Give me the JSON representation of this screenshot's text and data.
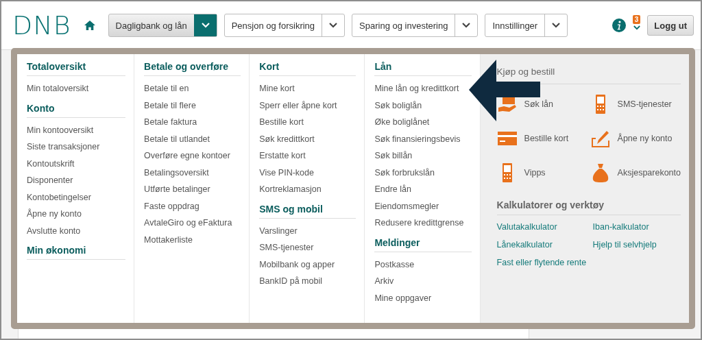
{
  "logo": "DNB",
  "nav": [
    {
      "label": "Dagligbank og lån",
      "selected": true
    },
    {
      "label": "Pensjon og forsikring",
      "selected": false
    },
    {
      "label": "Sparing og investering",
      "selected": false
    },
    {
      "label": "Innstillinger",
      "selected": false
    }
  ],
  "notification_count": "3",
  "logout": "Logg ut",
  "menu": {
    "columns": [
      {
        "sections": [
          {
            "heading": "Totaloversikt",
            "items": [
              "Min totaloversikt"
            ]
          },
          {
            "heading": "Konto",
            "items": [
              "Min kontooversikt",
              "Siste transaksjoner",
              "Kontoutskrift",
              "Disponenter",
              "Kontobetingelser",
              "Åpne ny konto",
              "Avslutte konto"
            ]
          },
          {
            "heading": "Min økonomi"
          }
        ]
      },
      {
        "sections": [
          {
            "heading": "Betale og overføre",
            "items": [
              "Betale til en",
              "Betale til flere",
              "Betale faktura",
              "Betale til utlandet",
              "Overføre egne kontoer",
              "Betalingsoversikt",
              "Utførte betalinger",
              "Faste oppdrag",
              "AvtaleGiro og eFaktura",
              "Mottakerliste"
            ]
          }
        ]
      },
      {
        "sections": [
          {
            "heading": "Kort",
            "items": [
              "Mine kort",
              "Sperr eller åpne kort",
              "Bestille kort",
              "Søk kredittkort",
              "Erstatte kort",
              "Vise PIN-kode",
              "Kortreklamasjon"
            ]
          },
          {
            "heading": "SMS og mobil",
            "items": [
              "Varslinger",
              "SMS-tjenester",
              "Mobilbank og apper",
              "BankID på mobil"
            ]
          }
        ]
      },
      {
        "sections": [
          {
            "heading": "Lån",
            "items": [
              "Mine lån og kredittkort",
              "Søk boliglån",
              "Øke boliglånet",
              "Søk finansieringsbevis",
              "Søk billån",
              "Søk forbrukslån",
              "Endre lån",
              "Eiendomsmegler",
              "Redusere kredittgrense"
            ]
          },
          {
            "heading": "Meldinger",
            "items": [
              "Postkasse",
              "Arkiv",
              "Mine oppgaver"
            ]
          }
        ]
      }
    ]
  },
  "buy": {
    "heading": "Kjøp og bestill",
    "items": [
      "Søk lån",
      "SMS-tjenester",
      "Bestille kort",
      "Åpne ny konto",
      "Vipps",
      "Aksjesparekonto"
    ]
  },
  "tools": {
    "heading": "Kalkulatorer og verktøy",
    "links": [
      "Valutakalkulator",
      "Iban-kalkulator",
      "Lånekalkulator",
      "Hjelp til selvhjelp",
      "Fast eller flytende rente"
    ]
  }
}
